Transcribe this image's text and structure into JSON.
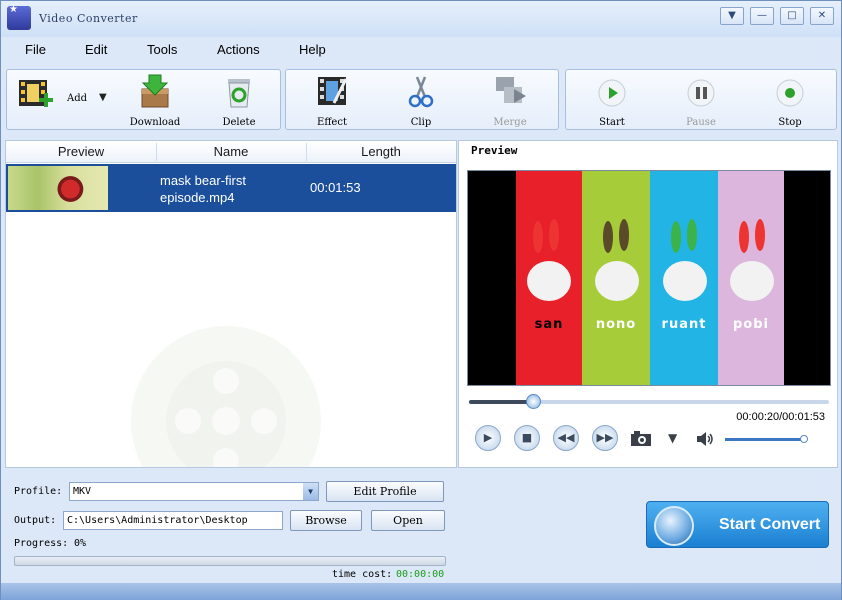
{
  "window": {
    "title": "Video Converter"
  },
  "window_controls": {
    "dropdown": "▼",
    "minimize": "—",
    "maximize": "□",
    "close": "✕"
  },
  "menu": [
    "File",
    "Edit",
    "Tools",
    "Actions",
    "Help"
  ],
  "toolbar": {
    "add": "Add",
    "download": "Download",
    "delete": "Delete",
    "effect": "Effect",
    "clip": "Clip",
    "merge": "Merge",
    "start": "Start",
    "pause": "Pause",
    "stop": "Stop"
  },
  "file_list": {
    "columns": [
      "Preview",
      "Name",
      "Length"
    ],
    "rows": [
      {
        "name": "mask bear-first episode.mp4",
        "length": "00:01:53"
      }
    ]
  },
  "preview": {
    "title": "Preview",
    "characters": [
      "san",
      "nono",
      "ruant",
      "pobi"
    ],
    "stripe_colors": [
      "#e8202a",
      "#a6cc3a",
      "#22b4e4",
      "#dcb6dc"
    ],
    "time": "00:00:20/00:01:53",
    "position_fraction": 0.177,
    "volume_fraction": 0.96
  },
  "bottom": {
    "profile_label": "Profile:",
    "profile_value": "MKV",
    "edit_profile": "Edit Profile",
    "output_label": "Output:",
    "output_value": "C:\\Users\\Administrator\\Desktop",
    "browse": "Browse",
    "open": "Open",
    "progress_label": "Progress:",
    "progress_value": "0%",
    "progress_fraction": 0,
    "time_cost_label": "time cost:",
    "time_cost_value": "00:00:00",
    "start_convert": "Start Convert"
  },
  "colors": {
    "selection": "#1b4f9c",
    "accent": "#1b7fd2",
    "time_cost": "#1aa01a"
  }
}
